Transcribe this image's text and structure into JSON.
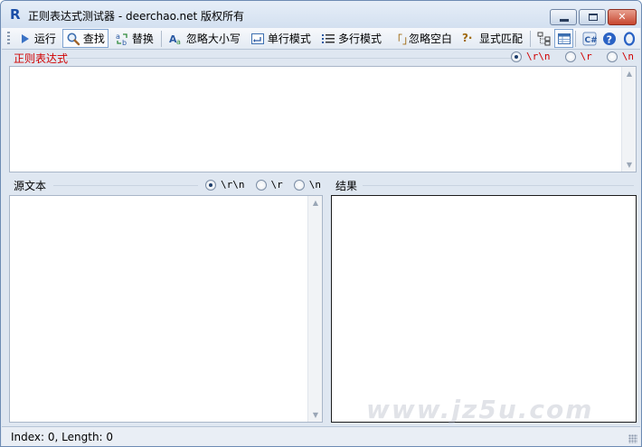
{
  "window": {
    "title": "正则表达式测试器 - deerchao.net 版权所有",
    "app_icon_glyph": "R"
  },
  "toolbar": {
    "run_label": "运行",
    "find_label": "查找",
    "replace_label": "替换",
    "ignore_case_label": "忽略大小写",
    "single_line_label": "单行模式",
    "multi_line_label": "多行模式",
    "ignore_whitespace_label": "忽略空白",
    "show_match_label": "显式匹配",
    "ignore_whitespace_glyph": "「」",
    "show_match_glyph": "?·",
    "active_mode": "find"
  },
  "regex": {
    "label": "正则表达式",
    "value": "",
    "newline_options": [
      "\\r\\n",
      "\\r",
      "\\n"
    ],
    "newline_selected": "\\r\\n"
  },
  "source": {
    "label": "源文本",
    "value": "",
    "newline_options": [
      "\\r\\n",
      "\\r",
      "\\n"
    ],
    "newline_selected": "\\r\\n"
  },
  "result": {
    "label": "结果",
    "value": ""
  },
  "status": {
    "text": "Index: 0, Length: 0"
  },
  "watermark": "www.jz5u.com",
  "colors": {
    "accent_red": "#d00000",
    "title_blue": "#1b4fa8",
    "close_red": "#c7462f"
  }
}
